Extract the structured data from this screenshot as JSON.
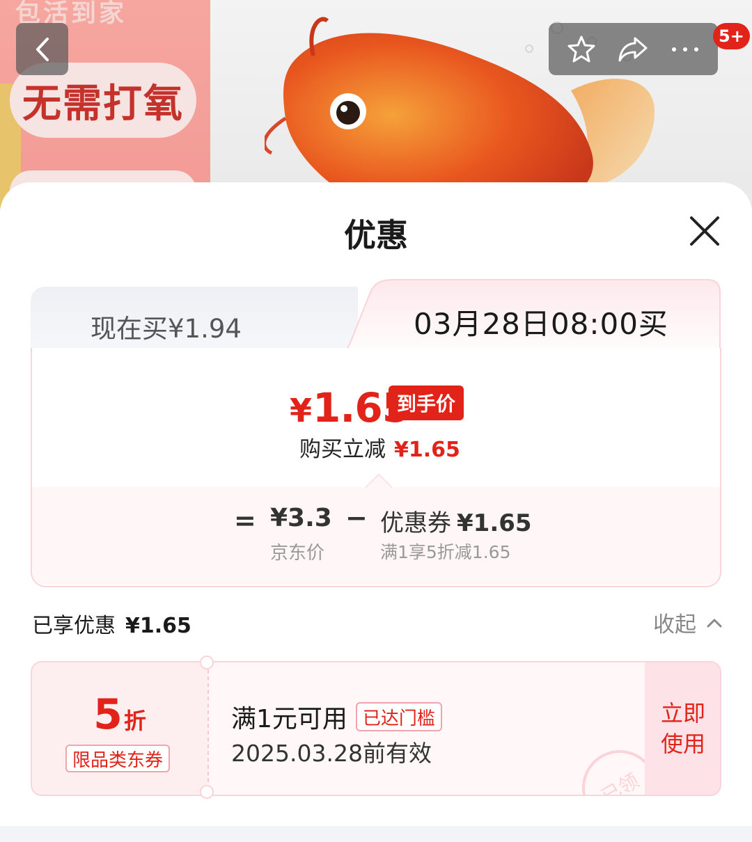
{
  "hero": {
    "promo_top_text": "包活到家",
    "promo_main_text": "无需打氧",
    "badge": "5+"
  },
  "sheet": {
    "title": "优惠"
  },
  "price_tabs": {
    "now": "现在买¥1.94",
    "later": "03月28日08:00买"
  },
  "final_price": {
    "yen": "¥",
    "amount": "1.65",
    "tag": "到手价",
    "reduce_label": "购买立减",
    "reduce_amount": "¥1.65"
  },
  "breakdown": {
    "equals": "=",
    "jd_price": "¥3.3",
    "jd_price_label": "京东价",
    "minus": "−",
    "coupon_label": "优惠券",
    "coupon_amount": "¥1.65",
    "coupon_desc": "满1享5折减1.65"
  },
  "enjoyed": {
    "label": "已享优惠",
    "amount": "¥1.65",
    "collapse": "收起"
  },
  "coupon": {
    "discount_num": "5",
    "discount_unit": "折",
    "type": "限品类东券",
    "condition": "满1元可用",
    "condition_tag": "已达门槛",
    "validity": "2025.03.28前有效",
    "stamp": "已领",
    "use_line1": "立即",
    "use_line2": "使用"
  },
  "colors": {
    "accent": "#e2231a",
    "pink_border": "#fbd4d9"
  }
}
